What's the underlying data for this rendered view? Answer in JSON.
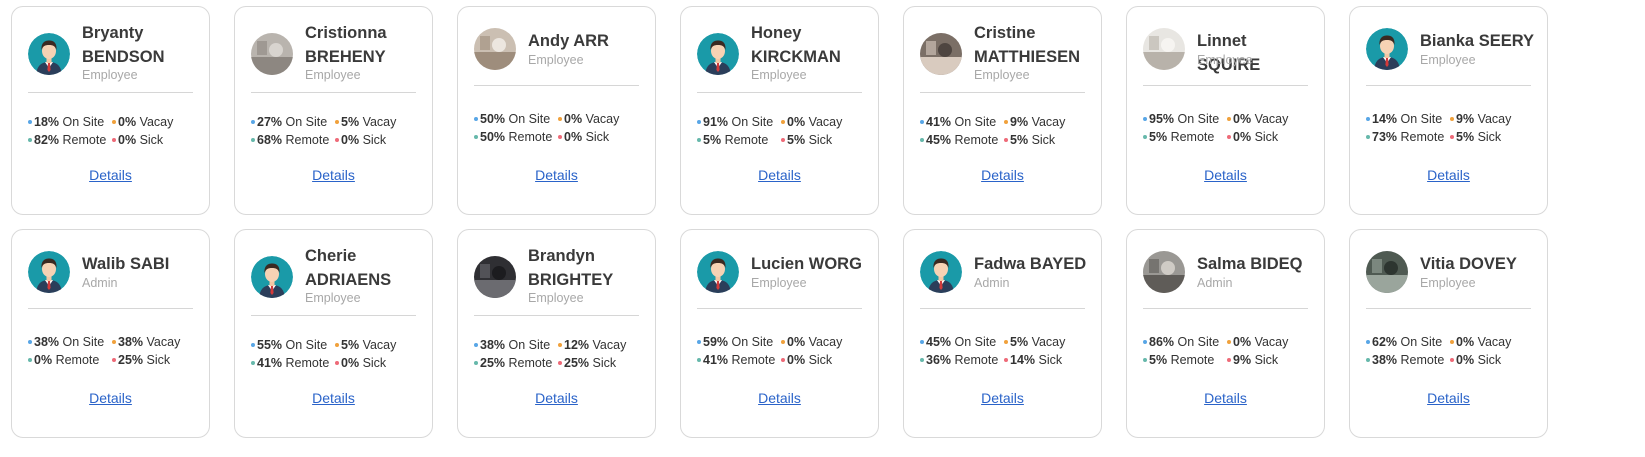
{
  "colors": {
    "onsite": "#58a6e6",
    "vacay": "#f0a13c",
    "remote": "#66b8ab",
    "sick": "#ee6a78",
    "link": "#2a63c9",
    "avatar_teal": "#1a9aa8"
  },
  "labels": {
    "onsite": "On Site",
    "vacay": "Vacay",
    "remote": "Remote",
    "sick": "Sick",
    "details": "Details"
  },
  "cards": [
    {
      "name": "Bryanty BENDSON",
      "role": "Employee",
      "avatar": "person-avatar",
      "onsite": "18%",
      "vacay": "0%",
      "remote": "82%",
      "sick": "0%"
    },
    {
      "name": "Cristionna BREHENY",
      "role": "Employee",
      "avatar": "photo-avatar",
      "onsite": "27%",
      "vacay": "5%",
      "remote": "68%",
      "sick": "0%"
    },
    {
      "name": "Andy ARR",
      "role": "Employee",
      "avatar": "photo-avatar",
      "onsite": "50%",
      "vacay": "0%",
      "remote": "50%",
      "sick": "0%"
    },
    {
      "name": "Honey KIRCKMAN",
      "role": "Employee",
      "avatar": "person-avatar",
      "onsite": "91%",
      "vacay": "0%",
      "remote": "5%",
      "sick": "5%"
    },
    {
      "name": "Cristine MATTHIESEN",
      "role": "Employee",
      "avatar": "photo-avatar",
      "onsite": "41%",
      "vacay": "9%",
      "remote": "45%",
      "sick": "5%"
    },
    {
      "name": "Linnet SQUIRE",
      "role": "Employee",
      "avatar": "photo-avatar",
      "onsite": "95%",
      "vacay": "0%",
      "remote": "5%",
      "sick": "0%"
    },
    {
      "name": "Bianka SEERY",
      "role": "Employee",
      "avatar": "person-avatar",
      "onsite": "14%",
      "vacay": "9%",
      "remote": "73%",
      "sick": "5%"
    },
    {
      "name": "Walib SABI",
      "role": "Admin",
      "avatar": "person-avatar",
      "onsite": "38%",
      "vacay": "38%",
      "remote": "0%",
      "sick": "25%"
    },
    {
      "name": "Cherie ADRIAENS",
      "role": "Employee",
      "avatar": "person-avatar",
      "onsite": "55%",
      "vacay": "5%",
      "remote": "41%",
      "sick": "0%"
    },
    {
      "name": "Brandyn BRIGHTEY",
      "role": "Employee",
      "avatar": "photo-avatar",
      "onsite": "38%",
      "vacay": "12%",
      "remote": "25%",
      "sick": "25%"
    },
    {
      "name": "Lucien WORG",
      "role": "Employee",
      "avatar": "person-avatar",
      "onsite": "59%",
      "vacay": "0%",
      "remote": "41%",
      "sick": "0%"
    },
    {
      "name": "Fadwa BAYED",
      "role": "Admin",
      "avatar": "person-avatar",
      "onsite": "45%",
      "vacay": "5%",
      "remote": "36%",
      "sick": "14%"
    },
    {
      "name": "Salma BIDEQ",
      "role": "Admin",
      "avatar": "photo-avatar",
      "onsite": "86%",
      "vacay": "0%",
      "remote": "5%",
      "sick": "9%"
    },
    {
      "name": "Vitia DOVEY",
      "role": "Employee",
      "avatar": "photo-avatar",
      "onsite": "62%",
      "vacay": "0%",
      "remote": "38%",
      "sick": "0%"
    }
  ]
}
